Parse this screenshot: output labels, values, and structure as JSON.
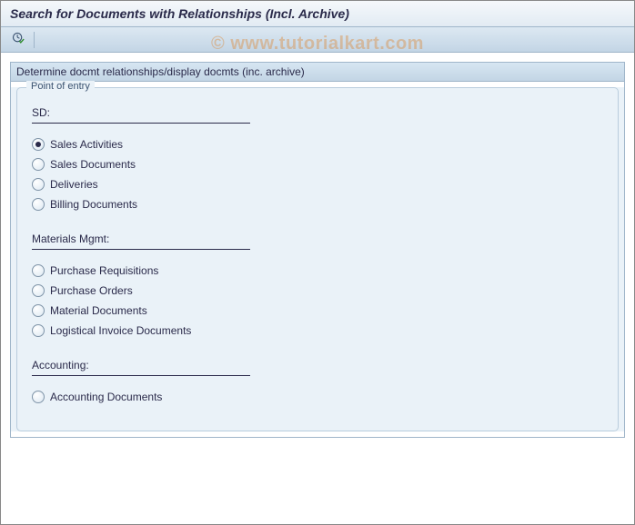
{
  "title": "Search for Documents with Relationships (Incl. Archive)",
  "watermark": "© www.tutorialkart.com",
  "panel": {
    "title": "Determine docmt relationships/display docmts (inc. archive)",
    "group_legend": "Point of entry",
    "sections": {
      "sd": {
        "header": "SD:",
        "options": [
          {
            "label": "Sales Activities",
            "selected": true
          },
          {
            "label": "Sales Documents",
            "selected": false
          },
          {
            "label": "Deliveries",
            "selected": false
          },
          {
            "label": "Billing Documents",
            "selected": false
          }
        ]
      },
      "mm": {
        "header": "Materials Mgmt:",
        "options": [
          {
            "label": "Purchase Requisitions",
            "selected": false
          },
          {
            "label": "Purchase Orders",
            "selected": false
          },
          {
            "label": "Material Documents",
            "selected": false
          },
          {
            "label": "Logistical Invoice Documents",
            "selected": false
          }
        ]
      },
      "acc": {
        "header": "Accounting:",
        "options": [
          {
            "label": "Accounting Documents",
            "selected": false
          }
        ]
      }
    }
  }
}
